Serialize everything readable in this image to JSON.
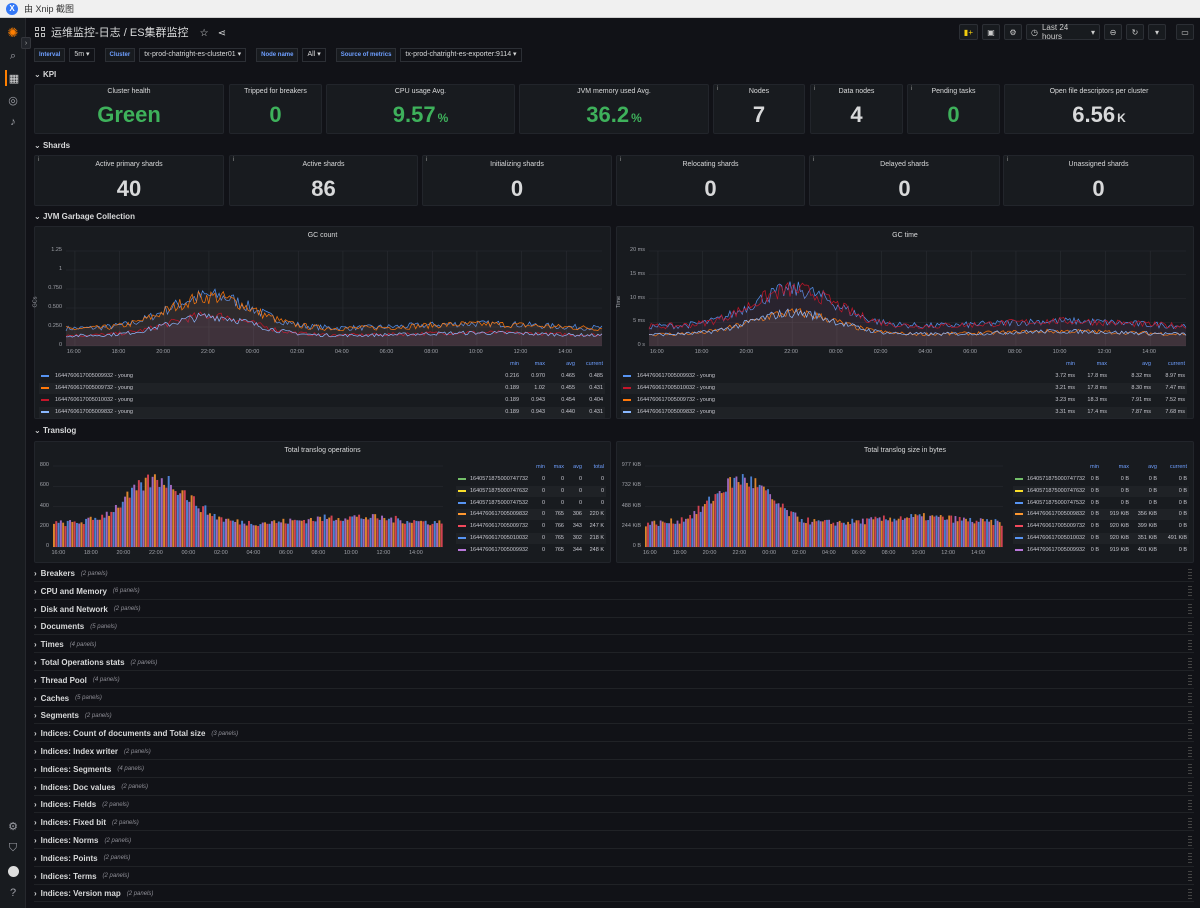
{
  "titlebar": {
    "app": "由 Xnip 截图"
  },
  "header": {
    "folder": "运维监控-日志",
    "dashboard": "ES集群监控",
    "time_range": "Last 24 hours"
  },
  "variables": [
    {
      "label": "Interval",
      "value": "5m"
    },
    {
      "label": "Cluster",
      "value": "tx-prod-chatright-es-cluster01"
    },
    {
      "label": "Node name",
      "value": "All"
    },
    {
      "label": "Source of metrics",
      "value": "tx-prod-chatright-es-exporter:9114"
    }
  ],
  "rows": {
    "kpi": "KPI",
    "shards": "Shards",
    "gc": "JVM Garbage Collection",
    "translog": "Translog"
  },
  "kpi": [
    {
      "title": "Cluster health",
      "value": "Green",
      "unit": "",
      "color": "#3eb15b"
    },
    {
      "title": "Tripped for breakers",
      "value": "0",
      "unit": "",
      "color": "#3eb15b"
    },
    {
      "title": "CPU usage Avg.",
      "value": "9.57",
      "unit": "%",
      "color": "#3eb15b"
    },
    {
      "title": "JVM memory used Avg.",
      "value": "36.2",
      "unit": "%",
      "color": "#3eb15b"
    },
    {
      "title": "Nodes",
      "value": "7",
      "unit": "",
      "color": "#d8d9da"
    },
    {
      "title": "Data nodes",
      "value": "4",
      "unit": "",
      "color": "#d8d9da"
    },
    {
      "title": "Pending tasks",
      "value": "0",
      "unit": "",
      "color": "#3eb15b"
    },
    {
      "title": "Open file descriptors per cluster",
      "value": "6.56",
      "unit": "K",
      "color": "#d8d9da"
    }
  ],
  "shards": [
    {
      "title": "Active primary shards",
      "value": "40"
    },
    {
      "title": "Active shards",
      "value": "86"
    },
    {
      "title": "Initializing shards",
      "value": "0"
    },
    {
      "title": "Relocating shards",
      "value": "0"
    },
    {
      "title": "Delayed shards",
      "value": "0"
    },
    {
      "title": "Unassigned shards",
      "value": "0"
    }
  ],
  "legend_headers": {
    "min": "min",
    "max": "max",
    "avg": "avg",
    "current": "current",
    "total": "total"
  },
  "chart_data": [
    {
      "type": "line",
      "title": "GC count",
      "ylabel": "GCs",
      "yticks": [
        "1.25",
        "1",
        "0.750",
        "0.500",
        "0.250",
        "0"
      ],
      "ylim": [
        0,
        1.25
      ],
      "xticks": [
        "16:00",
        "18:00",
        "20:00",
        "22:00",
        "00:00",
        "02:00",
        "04:00",
        "06:00",
        "08:00",
        "10:00",
        "12:00",
        "14:00"
      ],
      "series": [
        {
          "name": "1644760617005009932 - young",
          "color": "#5794f2",
          "min": "0.216",
          "max": "0.970",
          "avg": "0.465",
          "current": "0.485"
        },
        {
          "name": "1644760617005009732 - young",
          "color": "#ff780a",
          "min": "0.189",
          "max": "1.02",
          "avg": "0.455",
          "current": "0.431"
        },
        {
          "name": "1644760617005010032 - young",
          "color": "#c4162a",
          "min": "0.189",
          "max": "0.943",
          "avg": "0.454",
          "current": "0.404"
        },
        {
          "name": "1644760617005009832 - young",
          "color": "#8ab8ff",
          "min": "0.189",
          "max": "0.943",
          "avg": "0.440",
          "current": "0.431"
        }
      ]
    },
    {
      "type": "line",
      "title": "GC time",
      "ylabel": "Time",
      "yticks": [
        "20 ms",
        "15 ms",
        "10 ms",
        "5 ms",
        "0 s"
      ],
      "ylim": [
        0,
        20
      ],
      "xticks": [
        "16:00",
        "18:00",
        "20:00",
        "22:00",
        "00:00",
        "02:00",
        "04:00",
        "06:00",
        "08:00",
        "10:00",
        "12:00",
        "14:00"
      ],
      "series": [
        {
          "name": "1644760617005009932 - young",
          "color": "#5794f2",
          "min": "3.72 ms",
          "max": "17.8 ms",
          "avg": "8.32 ms",
          "current": "8.97 ms"
        },
        {
          "name": "1644760617005010032 - young",
          "color": "#c4162a",
          "min": "3.21 ms",
          "max": "17.8 ms",
          "avg": "8.30 ms",
          "current": "7.47 ms"
        },
        {
          "name": "1644760617005009732 - young",
          "color": "#ff780a",
          "min": "3.23 ms",
          "max": "18.3 ms",
          "avg": "7.91 ms",
          "current": "7.52 ms"
        },
        {
          "name": "1644760617005009832 - young",
          "color": "#8ab8ff",
          "min": "3.31 ms",
          "max": "17.4 ms",
          "avg": "7.87 ms",
          "current": "7.68 ms"
        }
      ]
    },
    {
      "type": "bar",
      "title": "Total translog operations",
      "yticks": [
        "800",
        "600",
        "400",
        "200",
        "0"
      ],
      "ylim": [
        0,
        800
      ],
      "xticks": [
        "16:00",
        "18:00",
        "20:00",
        "22:00",
        "00:00",
        "02:00",
        "04:00",
        "06:00",
        "08:00",
        "10:00",
        "12:00",
        "14:00"
      ],
      "series": [
        {
          "name": "1640571875000747732",
          "color": "#73bf69",
          "min": "0",
          "max": "0",
          "avg": "0",
          "total": "0"
        },
        {
          "name": "1640571875000747632",
          "color": "#fade2a",
          "min": "0",
          "max": "0",
          "avg": "0",
          "total": "0"
        },
        {
          "name": "1640571875000747532",
          "color": "#5794f2",
          "min": "0",
          "max": "0",
          "avg": "0",
          "total": "0"
        },
        {
          "name": "1644760617005009832",
          "color": "#ff9830",
          "min": "0",
          "max": "765",
          "avg": "306",
          "total": "220 K"
        },
        {
          "name": "1644760617005009732",
          "color": "#f2495c",
          "min": "0",
          "max": "766",
          "avg": "343",
          "total": "247 K"
        },
        {
          "name": "1644760617005010032",
          "color": "#5794f2",
          "min": "0",
          "max": "765",
          "avg": "302",
          "total": "218 K"
        },
        {
          "name": "1644760617005009932",
          "color": "#b877d9",
          "min": "0",
          "max": "765",
          "avg": "344",
          "total": "248 K"
        }
      ]
    },
    {
      "type": "bar",
      "title": "Total translog size in bytes",
      "yticks": [
        "977 KiB",
        "732 KiB",
        "488 KiB",
        "244 KiB",
        "0 B"
      ],
      "ylim": [
        0,
        977
      ],
      "xticks": [
        "16:00",
        "18:00",
        "20:00",
        "22:00",
        "00:00",
        "02:00",
        "04:00",
        "06:00",
        "08:00",
        "10:00",
        "12:00",
        "14:00"
      ],
      "series": [
        {
          "name": "1640571875000747732",
          "color": "#73bf69",
          "min": "0 B",
          "max": "0 B",
          "avg": "0 B",
          "current": "0 B"
        },
        {
          "name": "1640571875000747632",
          "color": "#fade2a",
          "min": "0 B",
          "max": "0 B",
          "avg": "0 B",
          "current": "0 B"
        },
        {
          "name": "1640571875000747532",
          "color": "#5794f2",
          "min": "0 B",
          "max": "0 B",
          "avg": "0 B",
          "current": "0 B"
        },
        {
          "name": "1644760617005009832",
          "color": "#ff9830",
          "min": "0 B",
          "max": "919 KiB",
          "avg": "356 KiB",
          "current": "0 B"
        },
        {
          "name": "1644760617005009732",
          "color": "#f2495c",
          "min": "0 B",
          "max": "920 KiB",
          "avg": "399 KiB",
          "current": "0 B"
        },
        {
          "name": "1644760617005010032",
          "color": "#5794f2",
          "min": "0 B",
          "max": "920 KiB",
          "avg": "351 KiB",
          "current": "491 KiB"
        },
        {
          "name": "1644760617005009932",
          "color": "#b877d9",
          "min": "0 B",
          "max": "919 KiB",
          "avg": "401 KiB",
          "current": "0 B"
        }
      ]
    }
  ],
  "collapsed_rows": [
    {
      "title": "Breakers",
      "count": "(2 panels)"
    },
    {
      "title": "CPU and Memory",
      "count": "(6 panels)"
    },
    {
      "title": "Disk and Network",
      "count": "(2 panels)"
    },
    {
      "title": "Documents",
      "count": "(5 panels)"
    },
    {
      "title": "Times",
      "count": "(4 panels)"
    },
    {
      "title": "Total Operations stats",
      "count": "(2 panels)"
    },
    {
      "title": "Thread Pool",
      "count": "(4 panels)"
    },
    {
      "title": "Caches",
      "count": "(5 panels)"
    },
    {
      "title": "Segments",
      "count": "(2 panels)"
    },
    {
      "title": "Indices: Count of documents and Total size",
      "count": "(3 panels)"
    },
    {
      "title": "Indices: Index writer",
      "count": "(2 panels)"
    },
    {
      "title": "Indices: Segments",
      "count": "(4 panels)"
    },
    {
      "title": "Indices: Doc values",
      "count": "(2 panels)"
    },
    {
      "title": "Indices: Fields",
      "count": "(2 panels)"
    },
    {
      "title": "Indices: Fixed bit",
      "count": "(2 panels)"
    },
    {
      "title": "Indices: Norms",
      "count": "(2 panels)"
    },
    {
      "title": "Indices: Points",
      "count": "(2 panels)"
    },
    {
      "title": "Indices: Terms",
      "count": "(2 panels)"
    },
    {
      "title": "Indices: Version map",
      "count": "(2 panels)"
    }
  ]
}
